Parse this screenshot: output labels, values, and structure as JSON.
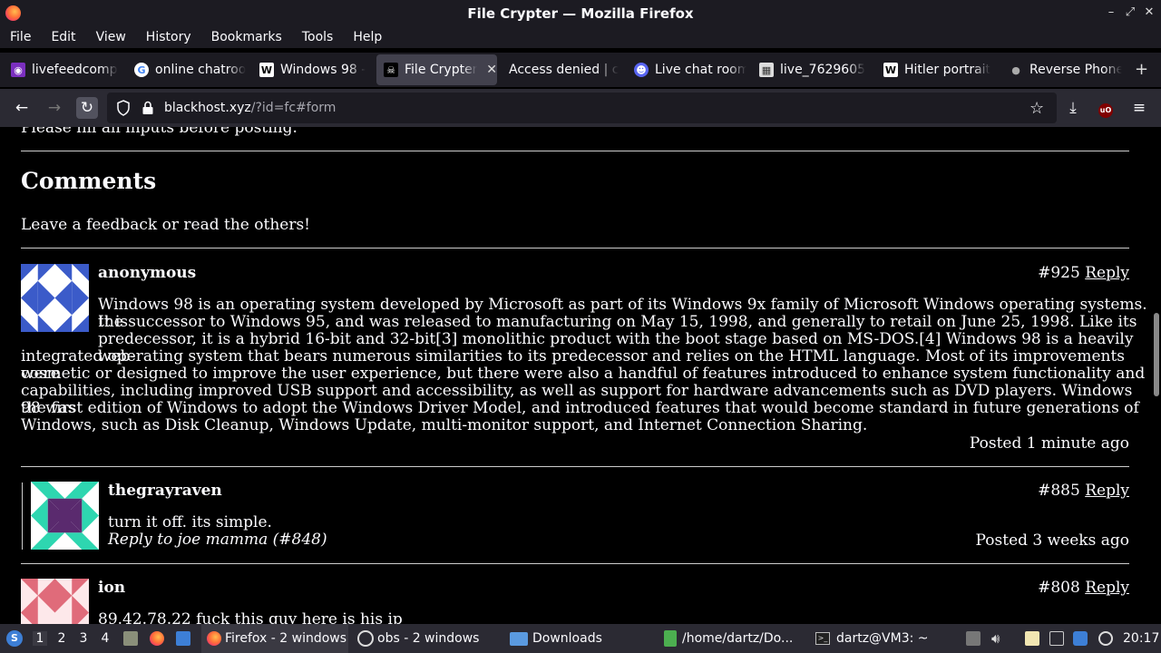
{
  "window": {
    "title": "File Crypter — Mozilla Firefox"
  },
  "menu": [
    "File",
    "Edit",
    "View",
    "History",
    "Bookmarks",
    "Tools",
    "Help"
  ],
  "tabs": [
    {
      "label": "livefeedcomp",
      "icon": "globe-icon"
    },
    {
      "label": "online chatroo",
      "icon": "google-icon"
    },
    {
      "label": "Windows 98 -",
      "icon": "wikipedia-icon"
    },
    {
      "label": "File Crypter",
      "icon": "pirate-icon",
      "active": true
    },
    {
      "label": "Access denied | c",
      "icon": "none"
    },
    {
      "label": "Live chat room",
      "icon": "chat-icon"
    },
    {
      "label": "live_7629605",
      "icon": "image-icon"
    },
    {
      "label": "Hitler portrait",
      "icon": "wikipedia-icon"
    },
    {
      "label": "Reverse Phone",
      "icon": "person-icon"
    }
  ],
  "nav": {
    "url_host": "blackhost.xyz",
    "url_rest": "/?id=fc#form"
  },
  "page": {
    "partial_top": "Please fill all inputs before posting.",
    "heading": "Comments",
    "subtitle": "Leave a feedback or read the others!",
    "comments": [
      {
        "user": "anonymous",
        "number": "#925",
        "reply_label": "Reply",
        "text_lines": [
          "Windows 98 is an operating system developed by Microsoft as part of its Windows 9x family of Microsoft Windows operating systems. It is",
          "the successor to Windows 95, and was released to manufacturing on May 15, 1998, and generally to retail on June 25, 1998. Like its",
          "predecessor, it is a hybrid 16-bit and 32-bit[3] monolithic product with the boot stage based on MS-DOS.[4] Windows 98 is a heavily web-",
          "integrated operating system that bears numerous similarities to its predecessor and relies on the HTML language. Most of its improvements were",
          "cosmetic or designed to improve the user experience, but there were also a handful of features introduced to enhance system functionality and",
          "capabilities, including improved USB support and accessibility, as well as support for hardware advancements such as DVD players. Windows 98 was",
          "the first edition of Windows to adopt the Windows Driver Model, and introduced features that would become standard in future generations of",
          "Windows, such as Disk Cleanup, Windows Update, multi-monitor support, and Internet Connection Sharing."
        ],
        "posted": "Posted 1 minute ago"
      },
      {
        "user": "thegrayraven",
        "number": "#885",
        "reply_label": "Reply",
        "text": "turn it off. its simple.",
        "reply_to": "Reply to joe mamma (#848)",
        "posted": "Posted 3 weeks ago"
      },
      {
        "user": "ion",
        "number": "#808",
        "reply_label": "Reply",
        "text": "89.42.78.22 fuck this guy here is his ip"
      }
    ]
  },
  "taskbar": {
    "workspaces": [
      "1",
      "2",
      "3",
      "4"
    ],
    "items": [
      {
        "label": "Firefox - 2 windows",
        "active": true
      },
      {
        "label": "obs - 2 windows"
      },
      {
        "label": "Downloads"
      },
      {
        "label": "/home/dartz/Do..."
      },
      {
        "label": "dartz@VM3: ~"
      }
    ],
    "clock": "20:17"
  }
}
